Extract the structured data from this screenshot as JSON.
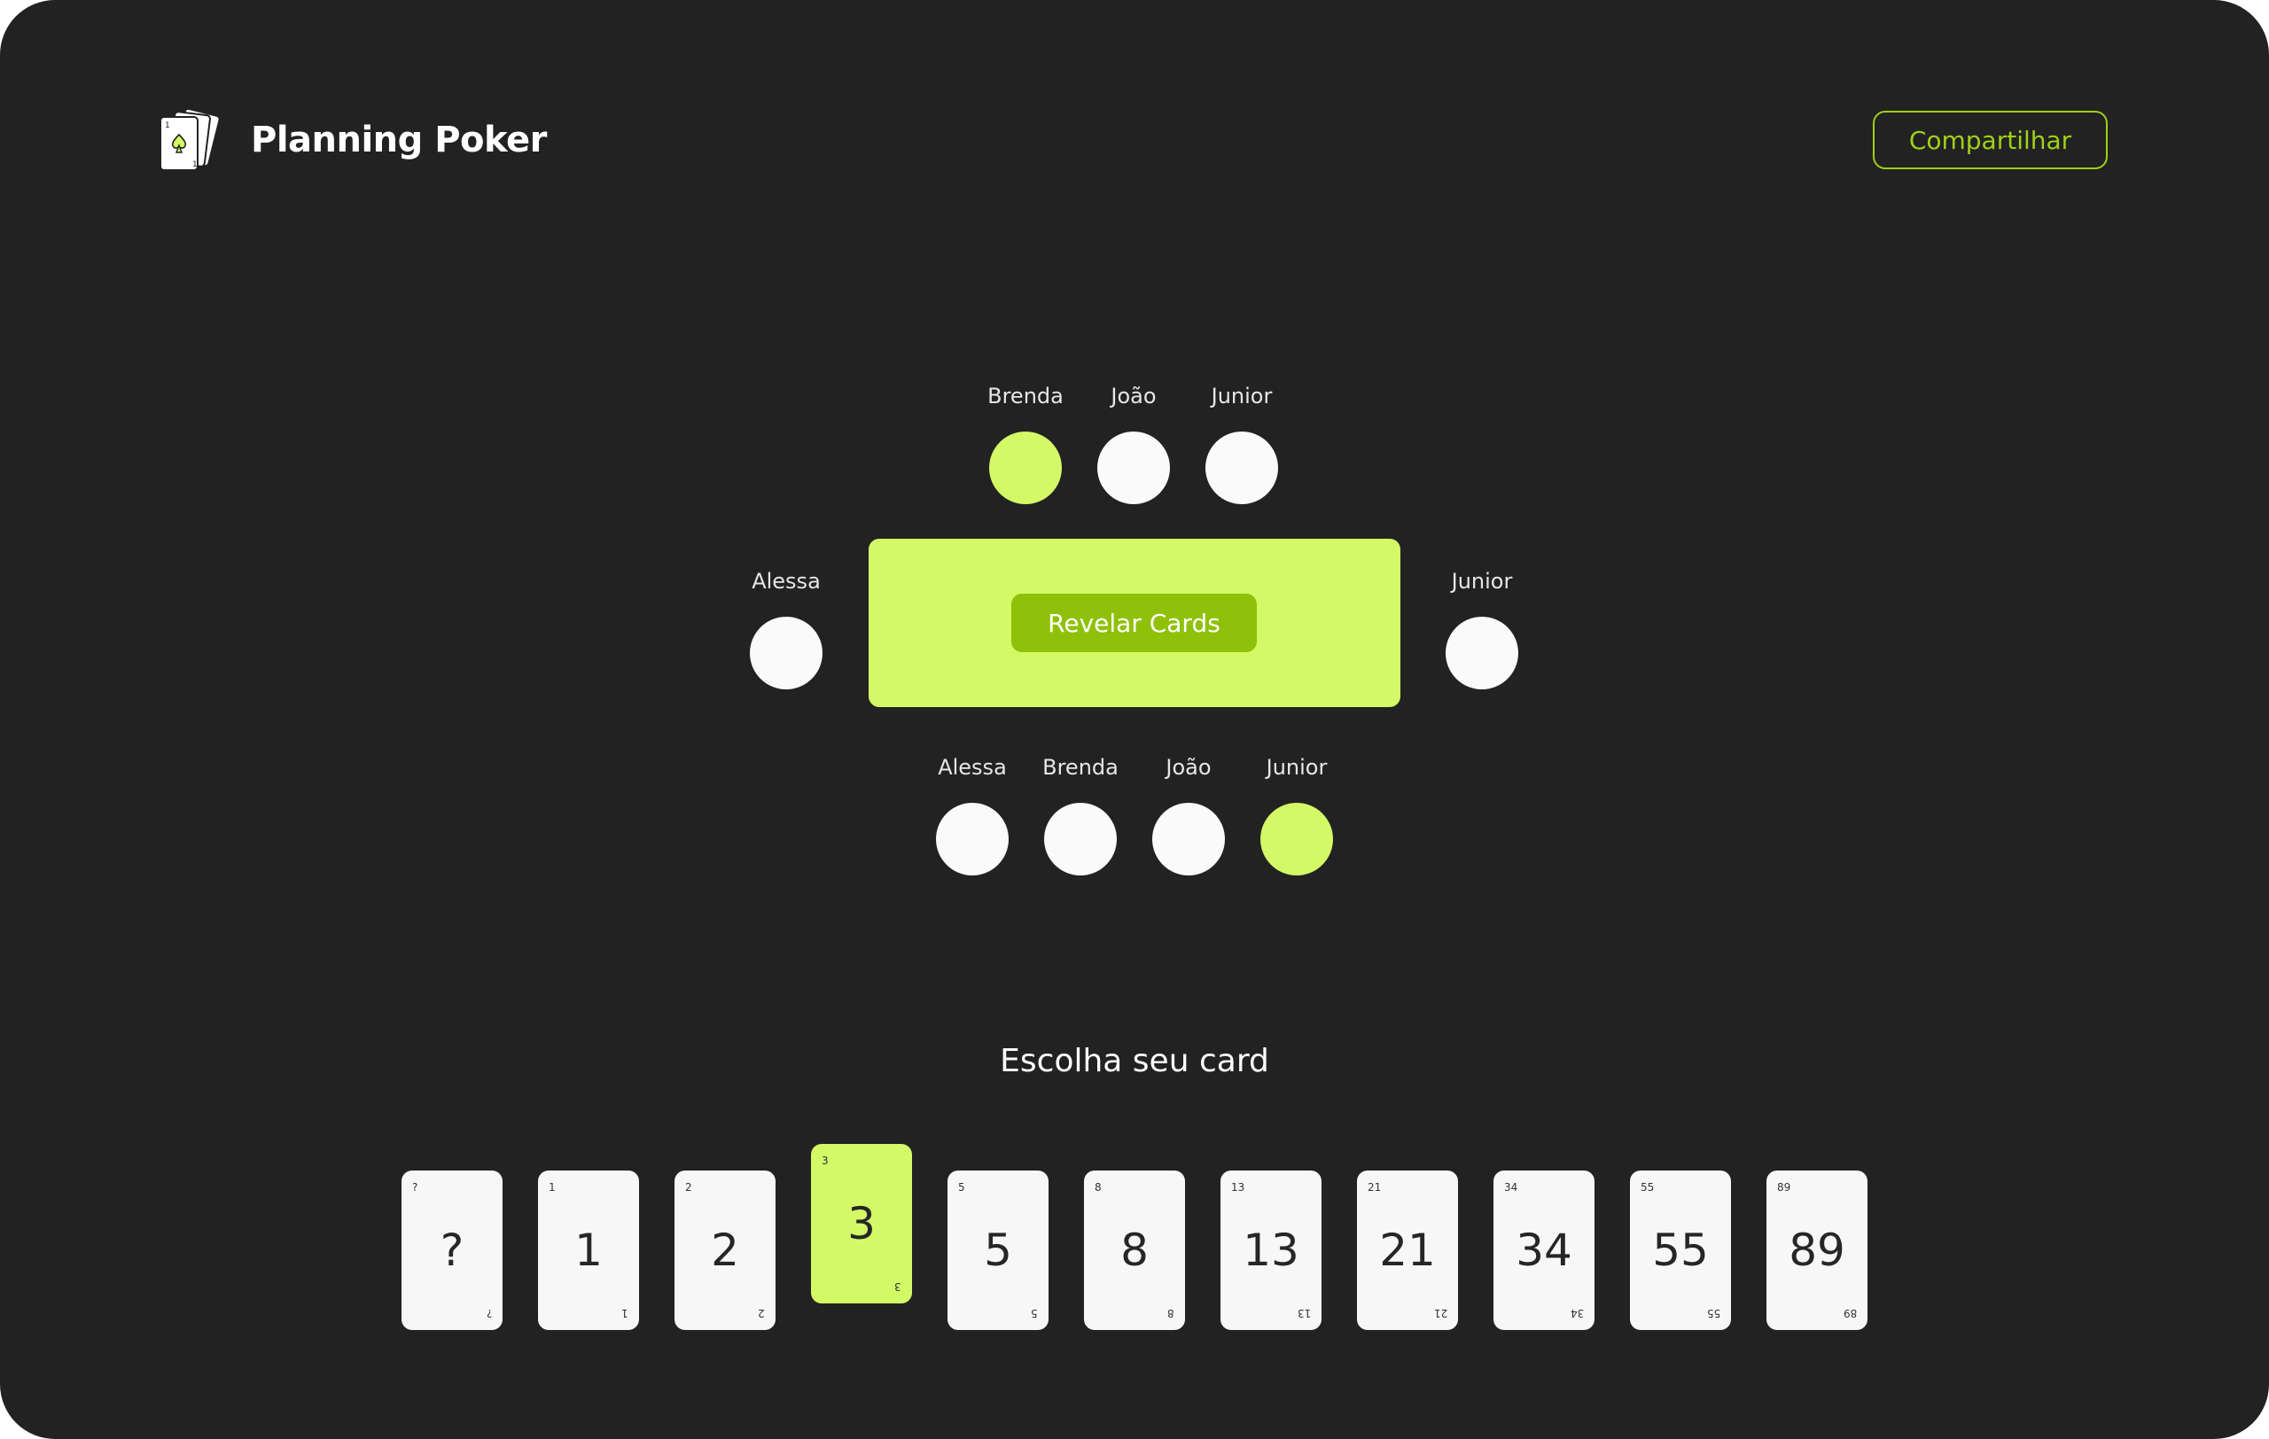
{
  "app": {
    "title": "Planning Poker",
    "logo_icon": "playing-cards-logo-icon"
  },
  "header": {
    "share_label": "Compartilhar"
  },
  "colors": {
    "background": "#222222",
    "accent": "#d3f967",
    "accent_dark": "#8fc10a",
    "share_border": "#9fd018",
    "card": "#f7f7f7"
  },
  "players": {
    "top": [
      {
        "name": "Brenda",
        "voted": true
      },
      {
        "name": "João",
        "voted": false
      },
      {
        "name": "Junior",
        "voted": false
      }
    ],
    "left": {
      "name": "Alessa",
      "voted": false
    },
    "right": {
      "name": "Junior",
      "voted": false
    },
    "bottom": [
      {
        "name": "Alessa",
        "voted": false
      },
      {
        "name": "Brenda",
        "voted": false
      },
      {
        "name": "João",
        "voted": false
      },
      {
        "name": "Junior",
        "voted": true
      }
    ]
  },
  "table": {
    "reveal_label": "Revelar Cards"
  },
  "deck": {
    "title": "Escolha seu card",
    "selected": "3",
    "cards": [
      "?",
      "1",
      "2",
      "3",
      "5",
      "8",
      "13",
      "21",
      "34",
      "55",
      "89"
    ]
  }
}
